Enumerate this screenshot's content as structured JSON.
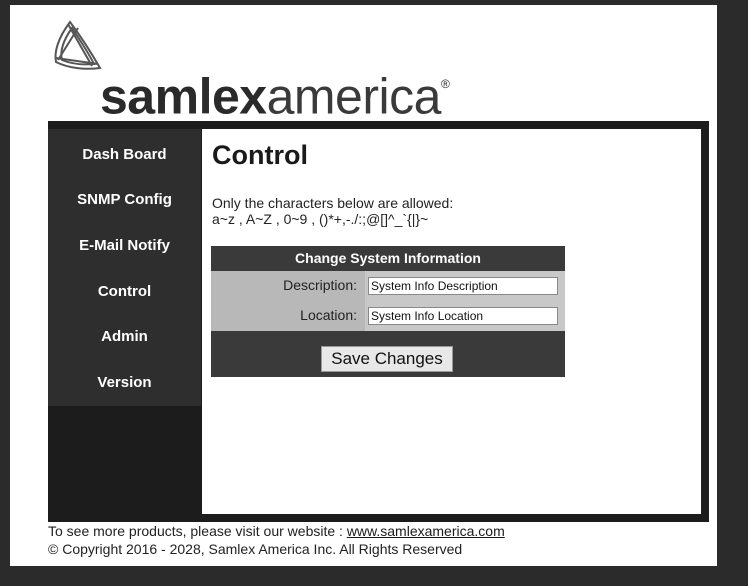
{
  "logo": {
    "brand_bold": "samlex",
    "brand_light": "america",
    "registered": "®"
  },
  "sidebar": {
    "items": [
      {
        "label": "Dash Board"
      },
      {
        "label": "SNMP Config"
      },
      {
        "label": "E-Mail Notify"
      },
      {
        "label": "Control"
      },
      {
        "label": "Admin"
      },
      {
        "label": "Version"
      }
    ]
  },
  "main": {
    "title": "Control",
    "note_line1": "Only the characters below are allowed:",
    "note_line2": "a~z , A~Z , 0~9 , ()*+,-./:;@[]^_`{|}~",
    "form": {
      "title": "Change System Information",
      "description_label": "Description:",
      "description_value": "System Info Description",
      "location_label": "Location:",
      "location_value": "System Info Location",
      "save_label": "Save Changes"
    }
  },
  "footer": {
    "visit_text": "To see more products, please visit our website : ",
    "website_link": "www.samlexamerica.com",
    "copyright": "© Copyright 2016 - 2028, Samlex America Inc. All Rights Reserved"
  }
}
